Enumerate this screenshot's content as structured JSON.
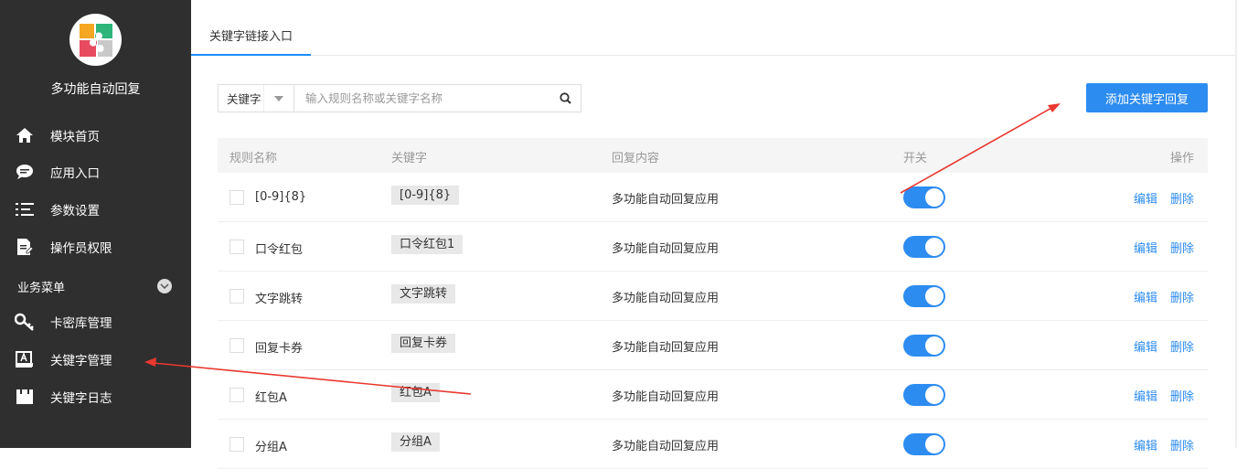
{
  "sidebar": {
    "app_title": "多功能自动回复",
    "items": [
      {
        "label": "模块首页",
        "icon": "home-icon"
      },
      {
        "label": "应用入口",
        "icon": "chat-bubble-icon"
      },
      {
        "label": "参数设置",
        "icon": "list-settings-icon"
      },
      {
        "label": "操作员权限",
        "icon": "document-edit-icon"
      }
    ],
    "section_label": "业务菜单",
    "section_items": [
      {
        "label": "卡密库管理",
        "icon": "key-icon"
      },
      {
        "label": "关键字管理",
        "icon": "keyword-book-icon"
      },
      {
        "label": "关键字日志",
        "icon": "log-book-icon"
      }
    ]
  },
  "tabs": [
    {
      "label": "关键字链接入口"
    }
  ],
  "search": {
    "filter_value": "关键字",
    "placeholder": "输入规则名称或关键字名称"
  },
  "add_button_label": "添加关键字回复",
  "table": {
    "headers": {
      "name": "规则名称",
      "keyword": "关键字",
      "content": "回复内容",
      "switch": "开关",
      "action": "操作"
    },
    "rows": [
      {
        "name": "[0-9]{8}",
        "keyword": "[0-9]{8}",
        "content": "多功能自动回复应用",
        "enabled": true
      },
      {
        "name": "口令红包",
        "keyword": "口令红包1",
        "content": "多功能自动回复应用",
        "enabled": true
      },
      {
        "name": "文字跳转",
        "keyword": "文字跳转",
        "content": "多功能自动回复应用",
        "enabled": true
      },
      {
        "name": "回复卡券",
        "keyword": "回复卡券",
        "content": "多功能自动回复应用",
        "enabled": true
      },
      {
        "name": "红包A",
        "keyword": "红包A",
        "content": "多功能自动回复应用",
        "enabled": true
      },
      {
        "name": "分组A",
        "keyword": "分组A",
        "content": "多功能自动回复应用",
        "enabled": true
      }
    ],
    "edit_label": "编辑",
    "delete_label": "删除"
  },
  "colors": {
    "primary": "#2d8cf0",
    "sidebar_bg": "#2f2f2f",
    "annotation_arrow": "#e8382f"
  }
}
